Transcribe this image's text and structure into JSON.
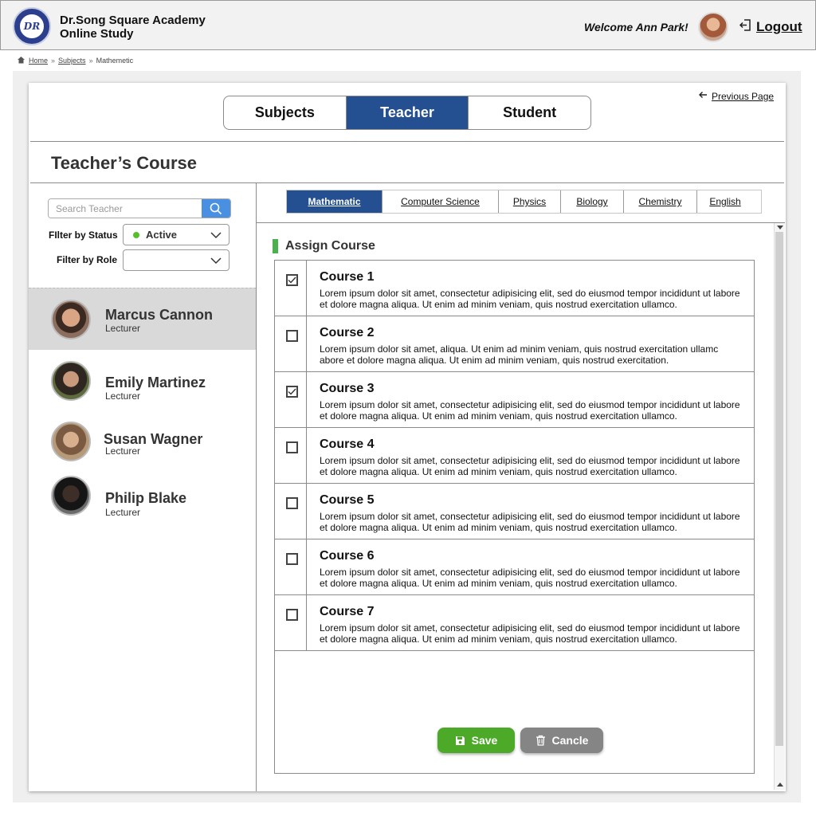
{
  "header": {
    "brand_line1": "Dr.Song Square Academy",
    "brand_line2": "Online Study",
    "logo_text": "DR",
    "welcome": "Welcome Ann Park!",
    "logout_label": "Logout"
  },
  "breadcrumb": {
    "home": "Home",
    "subjects": "Subjects",
    "current": "Mathemetic"
  },
  "top_tabs": [
    {
      "label": "Subjects",
      "active": false
    },
    {
      "label": "Teacher",
      "active": true
    },
    {
      "label": "Student",
      "active": false
    }
  ],
  "previous_page": "Previous Page",
  "page_title": "Teacher’s Course",
  "sidebar": {
    "search_placeholder": "Search Teacher",
    "filter_status_label": "FIlter by Status",
    "filter_status_value": "Active",
    "filter_role_label": "Filter by Role",
    "filter_role_value": "",
    "teachers": [
      {
        "name": "Marcus Cannon",
        "role": "Lecturer",
        "selected": true
      },
      {
        "name": "Emily Martinez",
        "role": "Lecturer",
        "selected": false
      },
      {
        "name": "Susan Wagner",
        "role": "Lecturer",
        "selected": false
      },
      {
        "name": "Philip Blake",
        "role": "Lecturer",
        "selected": false
      }
    ]
  },
  "subject_tabs": [
    {
      "label": "Mathematic",
      "active": true
    },
    {
      "label": "Computer Science",
      "active": false
    },
    {
      "label": "Physics",
      "active": false
    },
    {
      "label": "Biology",
      "active": false
    },
    {
      "label": "Chemistry",
      "active": false
    },
    {
      "label": "English",
      "active": false
    }
  ],
  "assign_title": "Assign Course",
  "courses": [
    {
      "title": "Course 1",
      "checked": true,
      "desc": "Lorem ipsum dolor sit amet, consectetur adipisicing elit, sed do eiusmod tempor incididunt ut labore et dolore magna aliqua. Ut enim ad minim veniam, quis nostrud exercitation ullamco."
    },
    {
      "title": "Course 2",
      "checked": false,
      "desc": "Lorem ipsum dolor sit amet, aliqua. Ut enim ad minim veniam, quis nostrud exercitation ullamc abore et dolore magna aliqua. Ut enim ad minim veniam, quis nostrud exercitation."
    },
    {
      "title": "Course 3",
      "checked": true,
      "desc": "Lorem ipsum dolor sit amet, consectetur adipisicing elit, sed do eiusmod tempor incididunt ut labore et dolore magna aliqua. Ut enim ad minim veniam, quis nostrud exercitation ullamco."
    },
    {
      "title": "Course 4",
      "checked": false,
      "desc": "Lorem ipsum dolor sit amet, consectetur adipisicing elit, sed do eiusmod tempor incididunt ut labore et dolore magna aliqua. Ut enim ad minim veniam, quis nostrud exercitation ullamco."
    },
    {
      "title": "Course 5",
      "checked": false,
      "desc": "Lorem ipsum dolor sit amet, consectetur adipisicing elit, sed do eiusmod tempor incididunt ut labore et dolore magna aliqua. Ut enim ad minim veniam, quis nostrud exercitation ullamco."
    },
    {
      "title": "Course 6",
      "checked": false,
      "desc": "Lorem ipsum dolor sit amet, consectetur adipisicing elit, sed do eiusmod tempor incididunt ut labore et dolore magna aliqua. Ut enim ad minim veniam, quis nostrud exercitation ullamco."
    },
    {
      "title": "Course 7",
      "checked": false,
      "desc": "Lorem ipsum dolor sit amet, consectetur adipisicing elit, sed do eiusmod tempor incididunt ut labore et dolore magna aliqua. Ut enim ad minim veniam, quis nostrud exercitation ullamco."
    }
  ],
  "buttons": {
    "save": "Save",
    "cancel": "Cancle"
  },
  "colors": {
    "primary": "#244f91",
    "save": "#4caa28",
    "cancel": "#858585",
    "status_active": "#56c02b",
    "search_button": "#4a90e2"
  }
}
